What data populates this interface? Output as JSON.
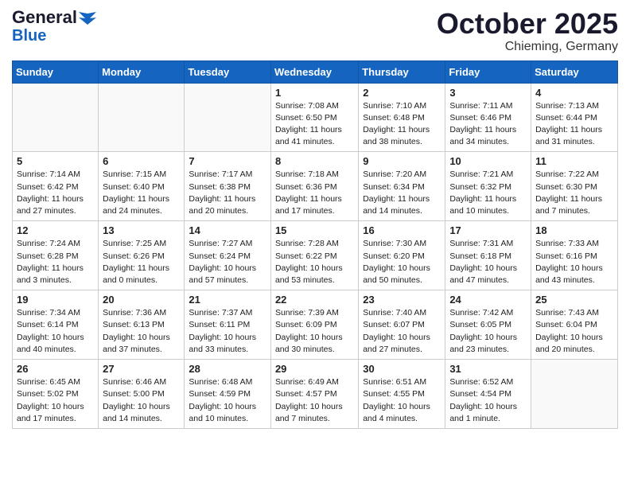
{
  "header": {
    "logo_line1": "General",
    "logo_line2": "Blue",
    "month": "October 2025",
    "location": "Chieming, Germany"
  },
  "weekdays": [
    "Sunday",
    "Monday",
    "Tuesday",
    "Wednesday",
    "Thursday",
    "Friday",
    "Saturday"
  ],
  "weeks": [
    [
      {
        "day": "",
        "info": ""
      },
      {
        "day": "",
        "info": ""
      },
      {
        "day": "",
        "info": ""
      },
      {
        "day": "1",
        "info": "Sunrise: 7:08 AM\nSunset: 6:50 PM\nDaylight: 11 hours and 41 minutes."
      },
      {
        "day": "2",
        "info": "Sunrise: 7:10 AM\nSunset: 6:48 PM\nDaylight: 11 hours and 38 minutes."
      },
      {
        "day": "3",
        "info": "Sunrise: 7:11 AM\nSunset: 6:46 PM\nDaylight: 11 hours and 34 minutes."
      },
      {
        "day": "4",
        "info": "Sunrise: 7:13 AM\nSunset: 6:44 PM\nDaylight: 11 hours and 31 minutes."
      }
    ],
    [
      {
        "day": "5",
        "info": "Sunrise: 7:14 AM\nSunset: 6:42 PM\nDaylight: 11 hours and 27 minutes."
      },
      {
        "day": "6",
        "info": "Sunrise: 7:15 AM\nSunset: 6:40 PM\nDaylight: 11 hours and 24 minutes."
      },
      {
        "day": "7",
        "info": "Sunrise: 7:17 AM\nSunset: 6:38 PM\nDaylight: 11 hours and 20 minutes."
      },
      {
        "day": "8",
        "info": "Sunrise: 7:18 AM\nSunset: 6:36 PM\nDaylight: 11 hours and 17 minutes."
      },
      {
        "day": "9",
        "info": "Sunrise: 7:20 AM\nSunset: 6:34 PM\nDaylight: 11 hours and 14 minutes."
      },
      {
        "day": "10",
        "info": "Sunrise: 7:21 AM\nSunset: 6:32 PM\nDaylight: 11 hours and 10 minutes."
      },
      {
        "day": "11",
        "info": "Sunrise: 7:22 AM\nSunset: 6:30 PM\nDaylight: 11 hours and 7 minutes."
      }
    ],
    [
      {
        "day": "12",
        "info": "Sunrise: 7:24 AM\nSunset: 6:28 PM\nDaylight: 11 hours and 3 minutes."
      },
      {
        "day": "13",
        "info": "Sunrise: 7:25 AM\nSunset: 6:26 PM\nDaylight: 11 hours and 0 minutes."
      },
      {
        "day": "14",
        "info": "Sunrise: 7:27 AM\nSunset: 6:24 PM\nDaylight: 10 hours and 57 minutes."
      },
      {
        "day": "15",
        "info": "Sunrise: 7:28 AM\nSunset: 6:22 PM\nDaylight: 10 hours and 53 minutes."
      },
      {
        "day": "16",
        "info": "Sunrise: 7:30 AM\nSunset: 6:20 PM\nDaylight: 10 hours and 50 minutes."
      },
      {
        "day": "17",
        "info": "Sunrise: 7:31 AM\nSunset: 6:18 PM\nDaylight: 10 hours and 47 minutes."
      },
      {
        "day": "18",
        "info": "Sunrise: 7:33 AM\nSunset: 6:16 PM\nDaylight: 10 hours and 43 minutes."
      }
    ],
    [
      {
        "day": "19",
        "info": "Sunrise: 7:34 AM\nSunset: 6:14 PM\nDaylight: 10 hours and 40 minutes."
      },
      {
        "day": "20",
        "info": "Sunrise: 7:36 AM\nSunset: 6:13 PM\nDaylight: 10 hours and 37 minutes."
      },
      {
        "day": "21",
        "info": "Sunrise: 7:37 AM\nSunset: 6:11 PM\nDaylight: 10 hours and 33 minutes."
      },
      {
        "day": "22",
        "info": "Sunrise: 7:39 AM\nSunset: 6:09 PM\nDaylight: 10 hours and 30 minutes."
      },
      {
        "day": "23",
        "info": "Sunrise: 7:40 AM\nSunset: 6:07 PM\nDaylight: 10 hours and 27 minutes."
      },
      {
        "day": "24",
        "info": "Sunrise: 7:42 AM\nSunset: 6:05 PM\nDaylight: 10 hours and 23 minutes."
      },
      {
        "day": "25",
        "info": "Sunrise: 7:43 AM\nSunset: 6:04 PM\nDaylight: 10 hours and 20 minutes."
      }
    ],
    [
      {
        "day": "26",
        "info": "Sunrise: 6:45 AM\nSunset: 5:02 PM\nDaylight: 10 hours and 17 minutes."
      },
      {
        "day": "27",
        "info": "Sunrise: 6:46 AM\nSunset: 5:00 PM\nDaylight: 10 hours and 14 minutes."
      },
      {
        "day": "28",
        "info": "Sunrise: 6:48 AM\nSunset: 4:59 PM\nDaylight: 10 hours and 10 minutes."
      },
      {
        "day": "29",
        "info": "Sunrise: 6:49 AM\nSunset: 4:57 PM\nDaylight: 10 hours and 7 minutes."
      },
      {
        "day": "30",
        "info": "Sunrise: 6:51 AM\nSunset: 4:55 PM\nDaylight: 10 hours and 4 minutes."
      },
      {
        "day": "31",
        "info": "Sunrise: 6:52 AM\nSunset: 4:54 PM\nDaylight: 10 hours and 1 minute."
      },
      {
        "day": "",
        "info": ""
      }
    ]
  ]
}
